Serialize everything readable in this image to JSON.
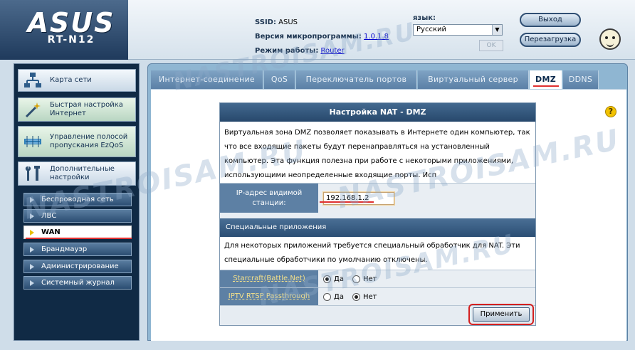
{
  "header": {
    "logo": "ASUS",
    "model": "RT-N12",
    "ssid_label": "SSID:",
    "ssid_value": "ASUS",
    "firmware_label": "Версия микропрограммы:",
    "firmware_value": "1.0.1.8",
    "mode_label": "Режим работы:",
    "mode_value": "Router",
    "language_label": "язык:",
    "language_value": "Русский",
    "ok_label": "OK",
    "logout_label": "Выход",
    "reboot_label": "Перезагрузка"
  },
  "sidebar": {
    "items": [
      {
        "label": "Карта сети",
        "icon": "network-map-icon"
      },
      {
        "label": "Быстрая настройка Интернет",
        "icon": "magic-wand-icon"
      },
      {
        "label": "Управление полосой пропускания EzQoS",
        "icon": "qos-icon"
      },
      {
        "label": "Дополнительные настройки",
        "icon": "tools-icon"
      }
    ],
    "sub_items": [
      {
        "label": "Беспроводная сеть"
      },
      {
        "label": "ЛВС"
      },
      {
        "label": "WAN",
        "active": true
      },
      {
        "label": "Брандмауэр"
      },
      {
        "label": "Администрирование"
      },
      {
        "label": "Системный журнал"
      }
    ]
  },
  "tabs": [
    {
      "label": "Интернет-соединение"
    },
    {
      "label": "QoS"
    },
    {
      "label": "Переключатель портов"
    },
    {
      "label": "Виртуальный сервер"
    },
    {
      "label": "DMZ",
      "active": true
    },
    {
      "label": "DDNS"
    }
  ],
  "panel": {
    "title": "Настройка NAT - DMZ",
    "description": "Виртуальная зона DMZ позволяет показывать в Интернете один компьютер, так что все входящие пакеты будут перенаправляться на установленный компьютер. Эта функция полезна при работе с некоторыми приложениями, использующими неопределенные входящие порты. Исп",
    "ip_label": "IP-адрес видимой станции:",
    "ip_value": "192.168.1.2",
    "special_header": "Специальные приложения",
    "special_description": "Для некоторых приложений требуется специальный обработчик для NAT. Эти специальные обработчики по умолчанию отключены.",
    "apps": [
      {
        "label": "Starcraft(Battle.Net)",
        "yes": "Да",
        "no": "Нет",
        "selected": "yes"
      },
      {
        "label": "IPTV RTSP Passthrough",
        "yes": "Да",
        "no": "Нет",
        "selected": "no"
      }
    ],
    "apply_label": "Применить"
  },
  "help_label": "?",
  "watermark": "NASTROISAM.RU"
}
